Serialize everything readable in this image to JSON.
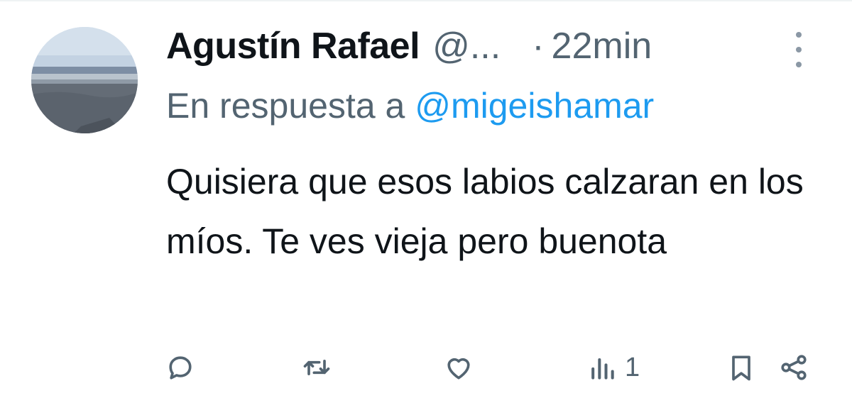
{
  "author": {
    "display_name": "Agustín Rafael",
    "handle": "@...",
    "separator": "·",
    "time": "22min"
  },
  "reply": {
    "prefix": "En respuesta a",
    "mention": "@migeishamar"
  },
  "tweet": {
    "text": "Quisiera que esos labios calzaran en los míos. Te ves vieja pero buenota"
  },
  "actions": {
    "reply_icon": "reply-bubble-icon",
    "retweet_icon": "retweet-icon",
    "like_icon": "heart-icon",
    "views_icon": "views-bar-chart-icon",
    "views_count": "1",
    "bookmark_icon": "bookmark-icon",
    "share_icon": "share-icon"
  },
  "colors": {
    "text_primary": "#0f1419",
    "text_secondary": "#536471",
    "link": "#1d9bf0"
  }
}
